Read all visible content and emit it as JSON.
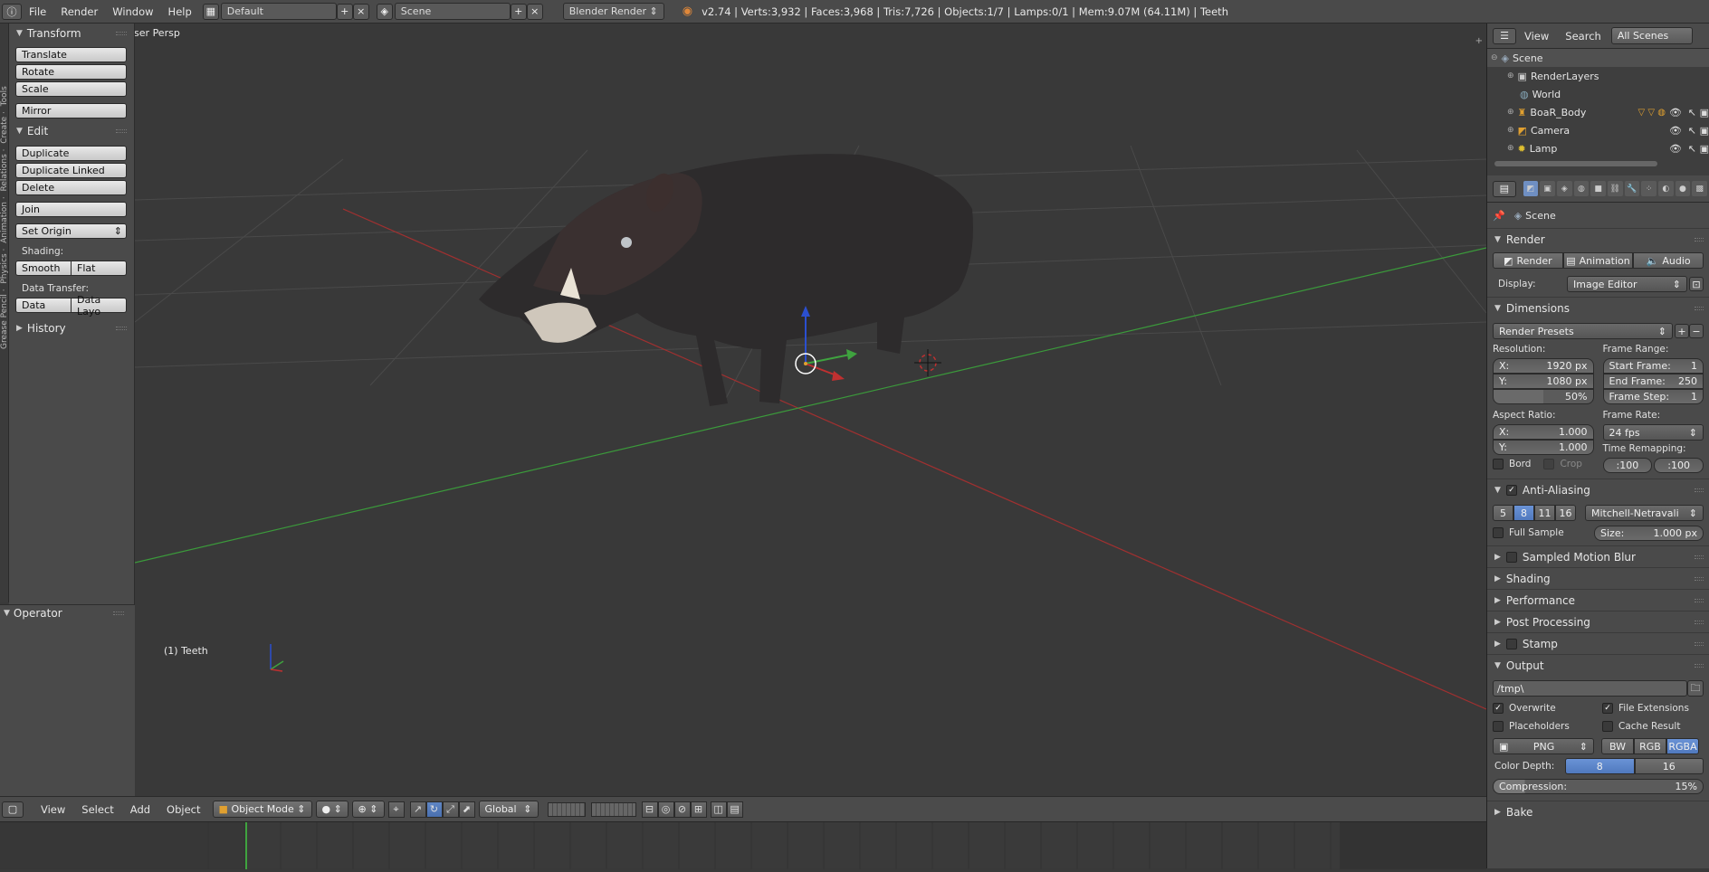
{
  "topbar": {
    "menus": [
      "File",
      "Render",
      "Window",
      "Help"
    ],
    "screen_layout": "Default",
    "scene": "Scene",
    "engine": "Blender Render",
    "stats": "v2.74 | Verts:3,932 | Faces:3,968 | Tris:7,726 | Objects:1/7 | Lamps:0/1 | Mem:9.07M (64.11M) | Teeth"
  },
  "toolshelf": {
    "transform": {
      "title": "Transform",
      "buttons": [
        "Translate",
        "Rotate",
        "Scale",
        "Mirror"
      ]
    },
    "edit": {
      "title": "Edit",
      "buttons": [
        "Duplicate",
        "Duplicate Linked",
        "Delete",
        "Join"
      ],
      "set_origin": "Set Origin"
    },
    "shading": {
      "label": "Shading:",
      "smooth": "Smooth",
      "flat": "Flat"
    },
    "data_transfer": {
      "label": "Data Transfer:",
      "data": "Data",
      "data_layo": "Data Layo"
    },
    "history": "History",
    "tab_labels": [
      "Tools",
      "Create",
      "Relations",
      "Animation",
      "Physics",
      "Grease Pencil"
    ]
  },
  "operator": {
    "title": "Operator"
  },
  "viewport": {
    "view_label": "User Persp",
    "object_label": "(1) Teeth"
  },
  "view_header": {
    "menus": [
      "View",
      "Select",
      "Add",
      "Object"
    ],
    "mode": "Object Mode",
    "orientation": "Global"
  },
  "outliner": {
    "menus": [
      "View",
      "Search"
    ],
    "filter": "All Scenes",
    "items": [
      {
        "label": "Scene"
      },
      {
        "label": "RenderLayers"
      },
      {
        "label": "World"
      },
      {
        "label": "BoaR_Body"
      },
      {
        "label": "Camera"
      },
      {
        "label": "Lamp"
      }
    ]
  },
  "properties": {
    "context": "Scene",
    "render": {
      "title": "Render",
      "buttons": [
        "Render",
        "Animation",
        "Audio"
      ],
      "display_label": "Display:",
      "display_value": "Image Editor"
    },
    "dimensions": {
      "title": "Dimensions",
      "presets": "Render Presets",
      "resolution_label": "Resolution:",
      "res_x": "1920 px",
      "res_y": "1080 px",
      "res_pct": "50%",
      "frame_range_label": "Frame Range:",
      "start_frame_label": "Start Frame:",
      "start_frame": "1",
      "end_frame_label": "End Frame:",
      "end_frame": "250",
      "frame_step_label": "Frame Step:",
      "frame_step": "1",
      "aspect_label": "Aspect Ratio:",
      "aspect_x": "1.000",
      "aspect_y": "1.000",
      "frame_rate_label": "Frame Rate:",
      "frame_rate": "24 fps",
      "time_remap_label": "Time Remapping:",
      "remap_old": ":100",
      "remap_new": ":100",
      "bord": "Bord",
      "crop": "Crop"
    },
    "antialiasing": {
      "title": "Anti-Aliasing",
      "samples": [
        "5",
        "8",
        "11",
        "16"
      ],
      "active_sample": "8",
      "filter": "Mitchell-Netravali",
      "full_sample": "Full Sample",
      "size_label": "Size:",
      "size": "1.000 px"
    },
    "collapsed_sections": [
      "Sampled Motion Blur",
      "Shading",
      "Performance",
      "Post Processing",
      "Stamp"
    ],
    "output": {
      "title": "Output",
      "path": "/tmp\\",
      "overwrite": "Overwrite",
      "file_extensions": "File Extensions",
      "placeholders": "Placeholders",
      "cache_result": "Cache Result",
      "format": "PNG",
      "color_modes": [
        "BW",
        "RGB",
        "RGBA"
      ],
      "active_color_mode": "RGBA",
      "color_depth_label": "Color Depth:",
      "depths": [
        "8",
        "16"
      ],
      "compression_label": "Compression:",
      "compression": "15%"
    },
    "bake_label": "Bake"
  },
  "colors": {
    "accent": "#5680c2",
    "x_axis": "#c03030",
    "y_axis": "#3fa33f",
    "z_axis": "#2b4fcf"
  }
}
